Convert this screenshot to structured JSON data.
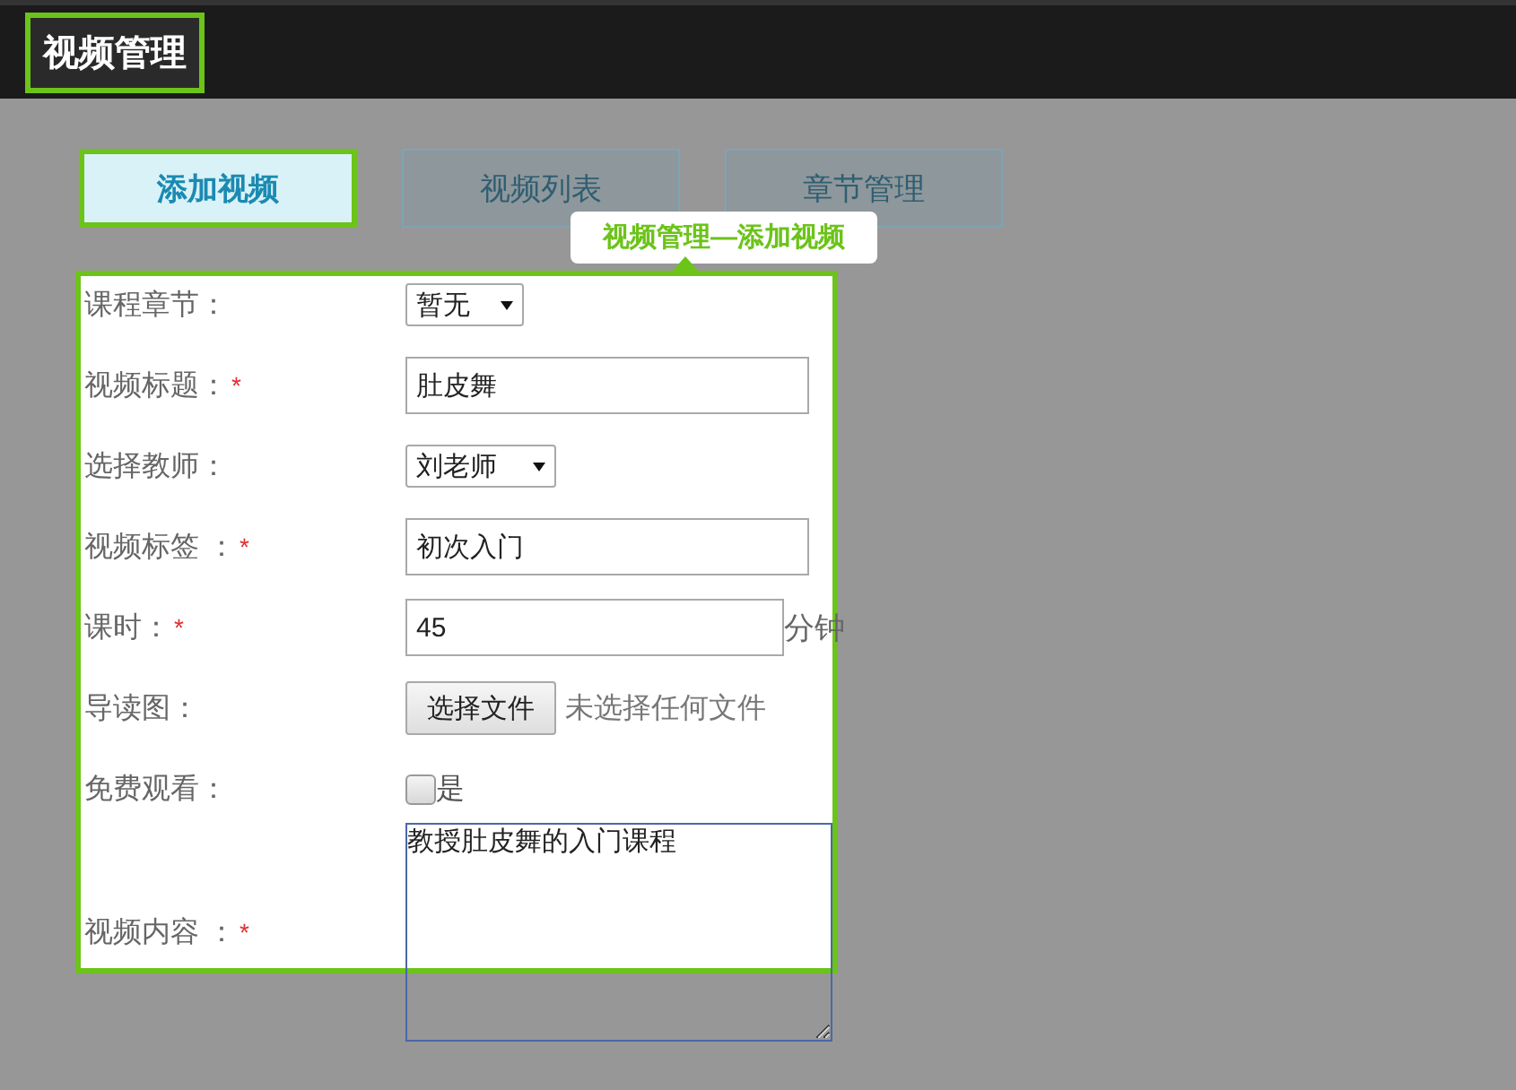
{
  "header": {
    "title": "视频管理"
  },
  "tabs": [
    {
      "label": "添加视频",
      "selected": true
    },
    {
      "label": "视频列表",
      "selected": false
    },
    {
      "label": "章节管理",
      "selected": false
    }
  ],
  "tooltip": {
    "text": "视频管理—添加视频"
  },
  "form": [
    {
      "kind": "select",
      "label": "课程章节：",
      "value": "暂无"
    },
    {
      "kind": "text",
      "label": "视频标题：",
      "mark": "*",
      "value": "肚皮舞"
    },
    {
      "kind": "select",
      "label": "选择教师：",
      "value": "刘老师"
    },
    {
      "kind": "text",
      "label": "视频标签 ：",
      "mark": "*",
      "value": "初次入门"
    },
    {
      "kind": "text",
      "label": "课时：",
      "mark": "*",
      "value": "45",
      "suffix": "分钟"
    },
    {
      "kind": "file",
      "label": "导读图：",
      "button": "选择文件",
      "status": "未选择任何文件"
    },
    {
      "kind": "checkbox",
      "label": "免费观看：",
      "option": "是",
      "checked": false
    },
    {
      "kind": "textarea",
      "label": "视频内容 ：",
      "mark": "*",
      "value": "教授肚皮舞的入门课程"
    }
  ]
}
